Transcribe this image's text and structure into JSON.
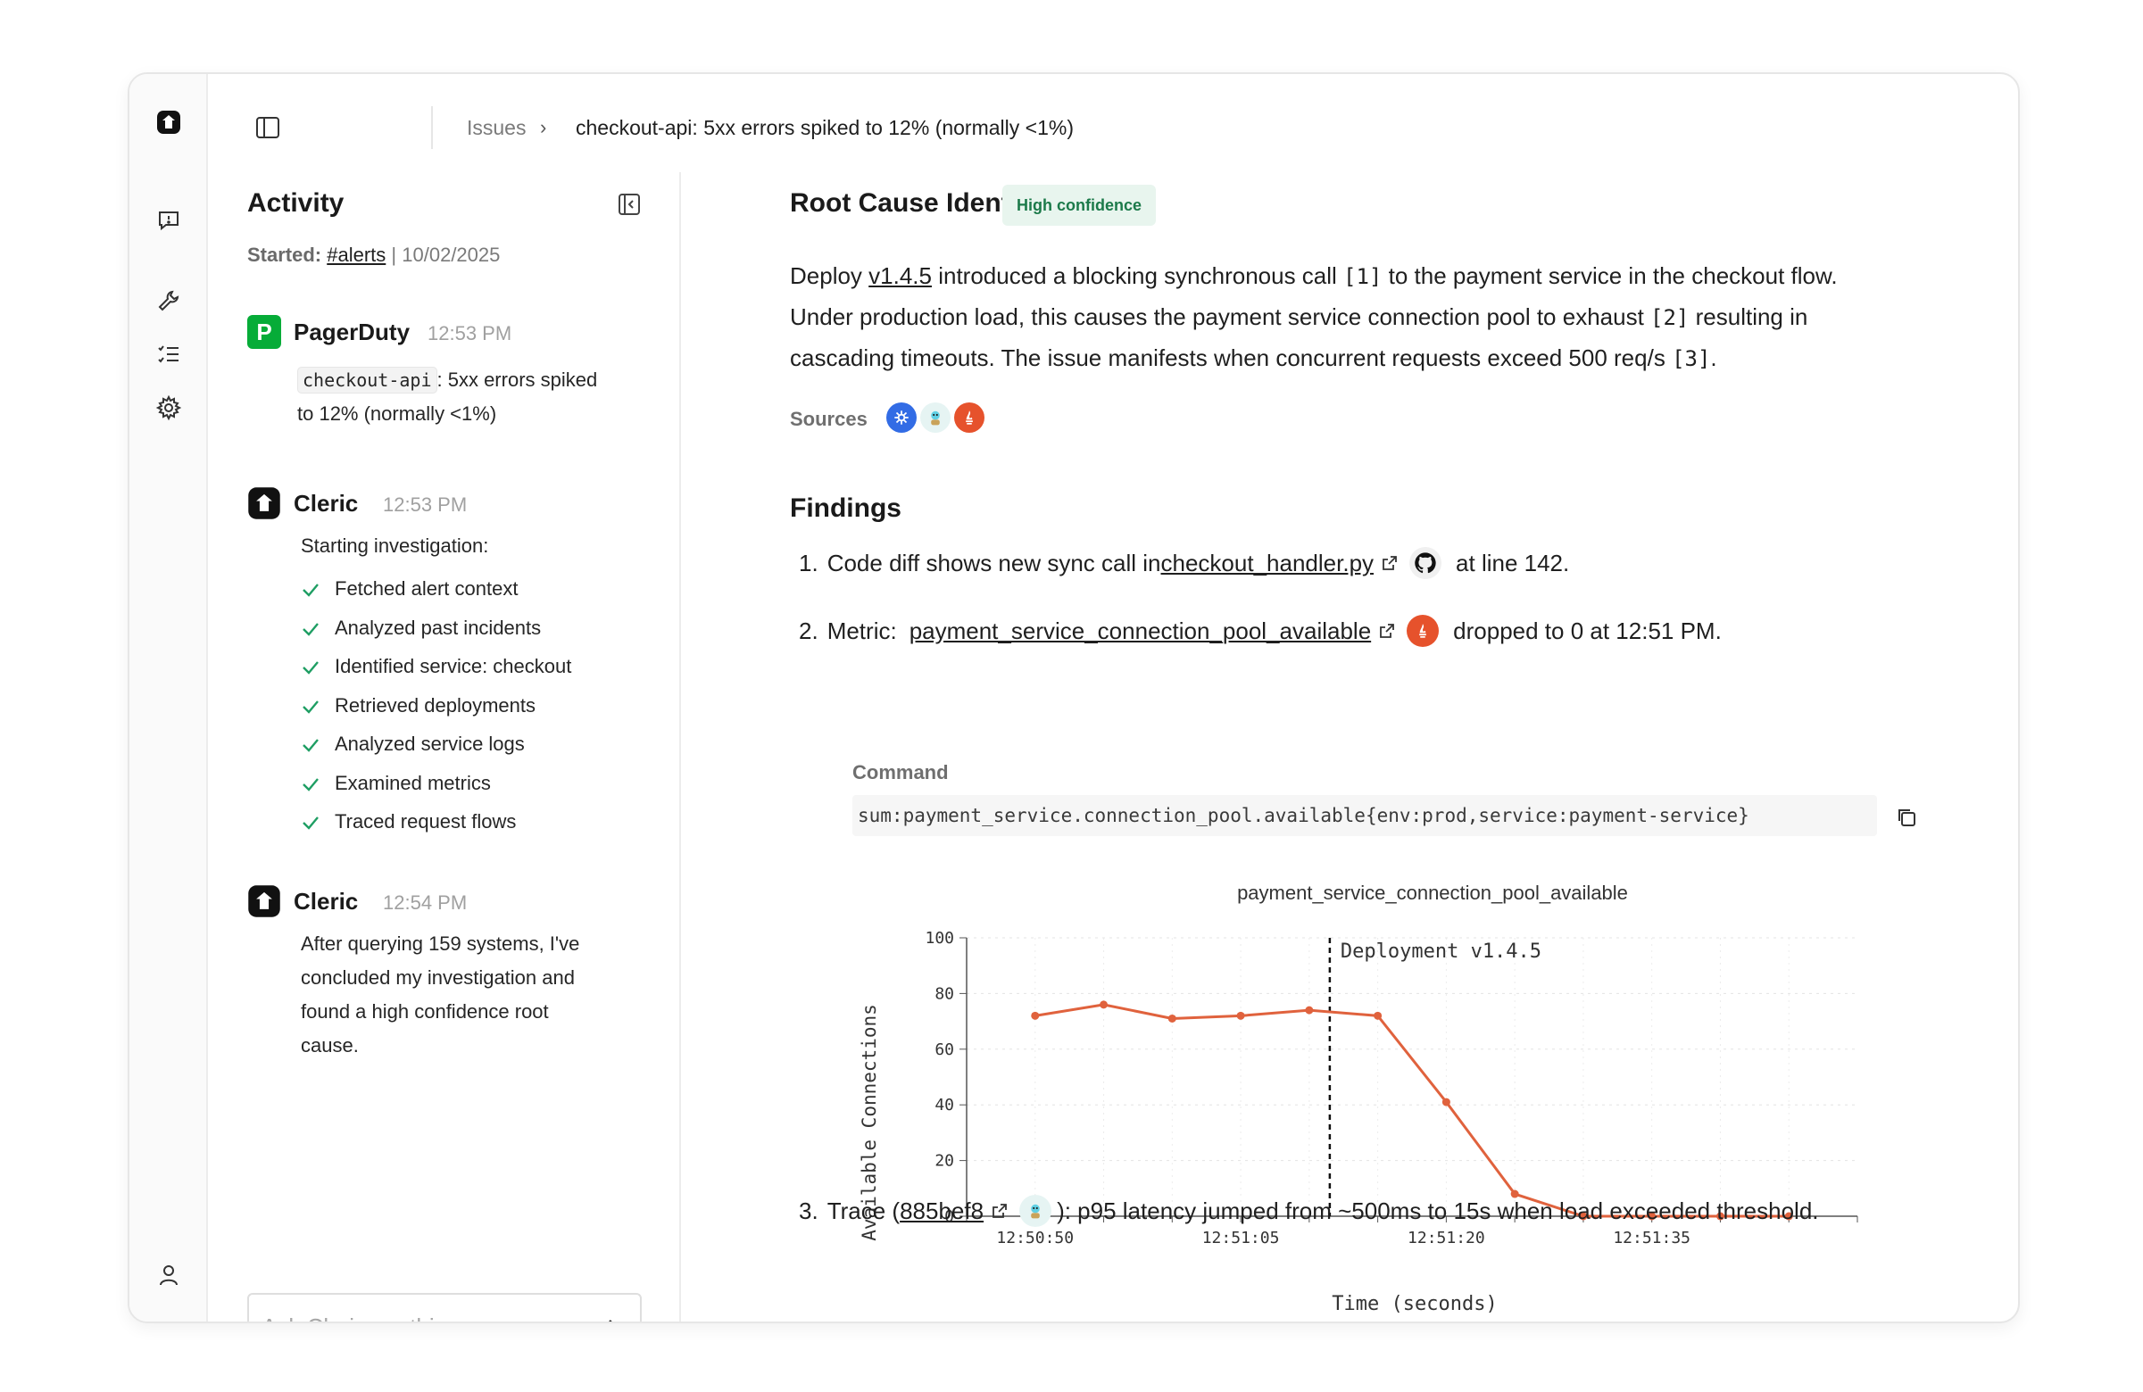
{
  "header": {
    "breadcrumb_root": "Issues",
    "breadcrumb_separator": "›",
    "breadcrumb_current": "checkout-api: 5xx errors spiked to 12% (normally <1%)"
  },
  "activity": {
    "title": "Activity",
    "started_label": "Started:",
    "started_channel": "#alerts",
    "started_sep": "|",
    "started_date": "10/02/2025",
    "events": [
      {
        "source": "PagerDuty",
        "badge": "P",
        "time": "12:53 PM",
        "code": "checkout-api",
        "text_1": ": 5xx errors spiked",
        "text_2": "to 12% (normally <1%)"
      },
      {
        "source": "Cleric",
        "time": "12:53 PM",
        "intro": "Starting investigation:",
        "steps": [
          "Fetched alert context",
          "Analyzed past incidents",
          "Identified service: checkout",
          "Retrieved deployments",
          "Analyzed service logs",
          "Examined metrics",
          "Traced request flows"
        ]
      },
      {
        "source": "Cleric",
        "time": "12:54 PM",
        "lines": [
          "After querying 159 systems, I've",
          "concluded my investigation and",
          "found a high confidence root",
          "cause."
        ]
      }
    ],
    "ask_placeholder": "Ask Cleric anything"
  },
  "root_cause": {
    "title": "Root Cause Identified",
    "confidence": "High confidence",
    "s1a": "Deploy ",
    "s1link": "v1.4.5",
    "s1b": " introduced a blocking synchronous call ",
    "ref1": "[1]",
    "s1c": " to the payment service in the checkout flow.",
    "s2a": "Under production load, this causes the payment service connection pool to exhaust ",
    "ref2": "[2]",
    "s2b": " resulting in",
    "s3a": "cascading timeouts. The issue manifests when concurrent requests exceed 500 req/s ",
    "ref3": "[3]",
    "s3b": ".",
    "sources_label": "Sources"
  },
  "findings": {
    "title": "Findings",
    "f1": {
      "num": "1.",
      "a": "Code diff shows new sync call in ",
      "link": "checkout_handler.py",
      "b": "at line 142."
    },
    "f2": {
      "num": "2.",
      "a": "Metric: ",
      "link": "payment_service_connection_pool_available",
      "b": "dropped to 0 at 12:51 PM."
    },
    "command_label": "Command",
    "command": "sum:payment_service.connection_pool.available{env:prod,service:payment-service}",
    "f3": {
      "num": "3.",
      "a": "Trace (",
      "link": "885bef8",
      "b": "): p95 latency jumped from ~500ms to 15s when load exceeded threshold."
    }
  },
  "colors": {
    "accent_green": "#1c7a4a",
    "pagerduty": "#06ac38",
    "line": "#e0623d",
    "check": "#1e9e63"
  },
  "chart_data": {
    "type": "line",
    "title": "payment_service_connection_pool_available",
    "xlabel": "Time (seconds)",
    "ylabel": "Available Connections",
    "x_ticks": [
      "12:50:50",
      "12:51:05",
      "12:51:20",
      "12:51:35"
    ],
    "y_ticks": [
      0,
      20,
      40,
      60,
      80,
      100
    ],
    "ylim": [
      0,
      100
    ],
    "xlim": [
      -5,
      60
    ],
    "x": [
      0,
      5,
      10,
      15,
      20,
      25,
      30,
      35,
      40,
      45,
      50,
      55
    ],
    "values": [
      72,
      76,
      71,
      72,
      74,
      72,
      41,
      8,
      0,
      0,
      0,
      0
    ],
    "annotation": {
      "label": "Deployment v1.4.5",
      "x": 21.5
    },
    "grid": true
  }
}
